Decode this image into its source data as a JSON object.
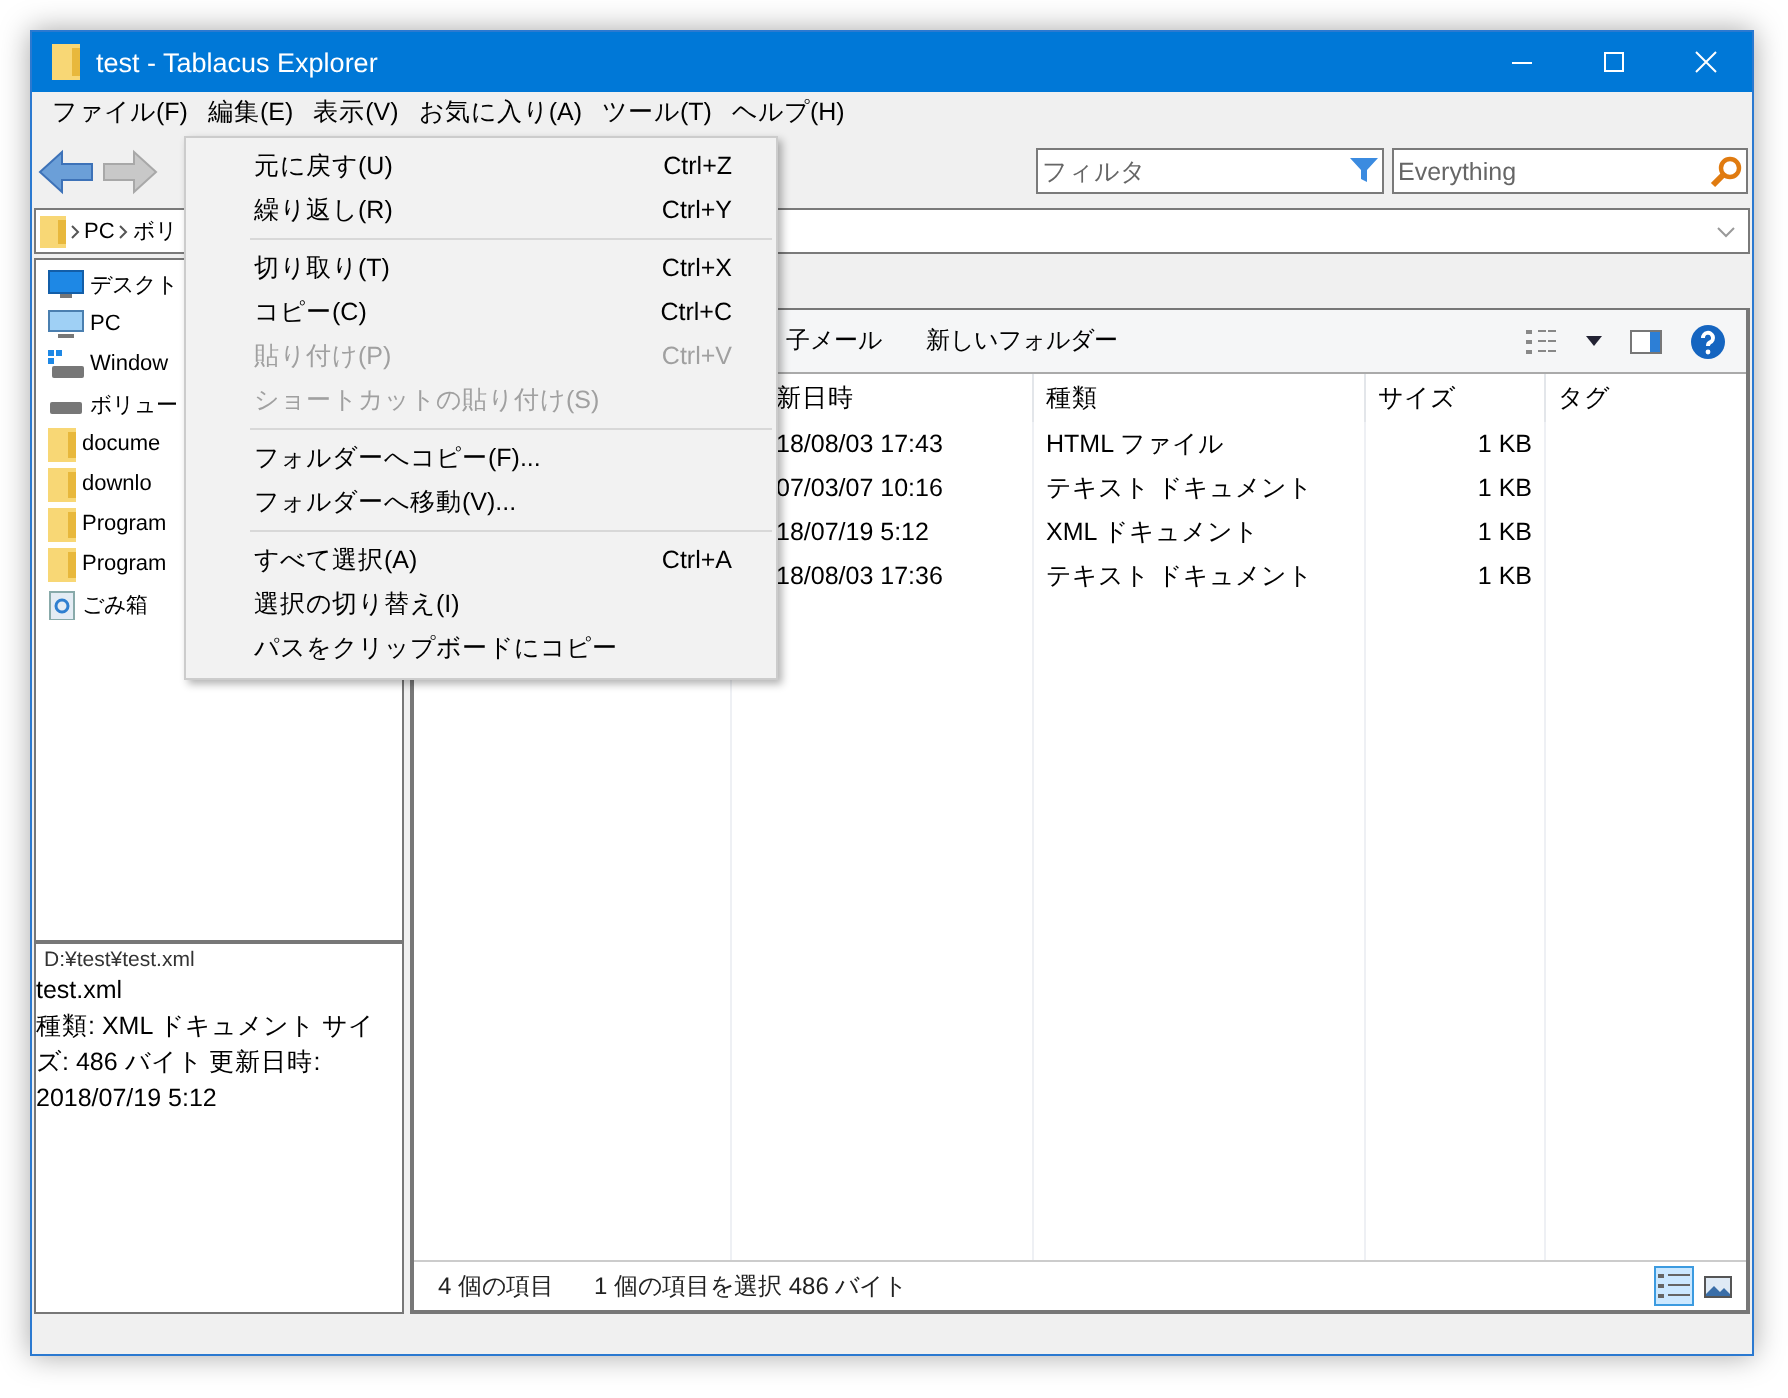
{
  "window": {
    "title": "test - Tablacus Explorer"
  },
  "menubar": [
    {
      "label": "ファイル(F)"
    },
    {
      "label": "編集(E)"
    },
    {
      "label": "表示(V)"
    },
    {
      "label": "お気に入り(A)"
    },
    {
      "label": "ツール(T)"
    },
    {
      "label": "ヘルプ(H)"
    }
  ],
  "filter": {
    "placeholder": "フィルタ"
  },
  "search": {
    "placeholder": "Everything"
  },
  "address": {
    "crumbs": [
      "PC",
      "ボリ"
    ]
  },
  "tree": [
    {
      "label": "デスクト",
      "kind": "desktop"
    },
    {
      "label": "PC",
      "kind": "pc"
    },
    {
      "label": "Window",
      "kind": "system-drive"
    },
    {
      "label": "ボリュー",
      "kind": "drive"
    },
    {
      "label": "docume",
      "kind": "folder"
    },
    {
      "label": "downlo",
      "kind": "folder"
    },
    {
      "label": "Program",
      "kind": "folder"
    },
    {
      "label": "Program",
      "kind": "folder"
    },
    {
      "label": "ごみ箱",
      "kind": "recycle"
    }
  ],
  "info": {
    "path": "D:¥test¥test.xml",
    "name": "test.xml",
    "details": "種類: XML ドキュメント サイズ: 486 バイト 更新日時: 2018/07/19 5:12"
  },
  "command_bar": {
    "items": [
      "子メール",
      "新しいフォルダー"
    ]
  },
  "table": {
    "columns": [
      "新日時",
      "種類",
      "サイズ",
      "タグ"
    ],
    "rows": [
      {
        "date": "18/08/03 17:43",
        "type": "HTML ファイル",
        "size": "1 KB"
      },
      {
        "date": "07/03/07 10:16",
        "type": "テキスト ドキュメント",
        "size": "1 KB"
      },
      {
        "date": "18/07/19 5:12",
        "type": "XML ドキュメント",
        "size": "1 KB"
      },
      {
        "date": "18/08/03 17:36",
        "type": "テキスト ドキュメント",
        "size": "1 KB"
      }
    ]
  },
  "status_bar": {
    "items": [
      "4 個の項目",
      "1 個の項目を選択  486 バイト"
    ],
    "views": [
      {
        "kind": "details",
        "selected": true
      },
      {
        "kind": "preview",
        "selected": false
      }
    ]
  },
  "context_menu": {
    "items": [
      {
        "kind": "item",
        "label": "元に戻す(U)",
        "shortcut": "Ctrl+Z",
        "disabled": false
      },
      {
        "kind": "item",
        "label": "繰り返し(R)",
        "shortcut": "Ctrl+Y",
        "disabled": false
      },
      {
        "kind": "separator"
      },
      {
        "kind": "item",
        "label": "切り取り(T)",
        "shortcut": "Ctrl+X",
        "disabled": false
      },
      {
        "kind": "item",
        "label": "コピー(C)",
        "shortcut": "Ctrl+C",
        "disabled": false
      },
      {
        "kind": "item",
        "label": "貼り付け(P)",
        "shortcut": "Ctrl+V",
        "disabled": true
      },
      {
        "kind": "item",
        "label": "ショートカットの貼り付け(S)",
        "disabled": true
      },
      {
        "kind": "separator"
      },
      {
        "kind": "item",
        "label": "フォルダーへコピー(F)...",
        "disabled": false
      },
      {
        "kind": "item",
        "label": "フォルダーへ移動(V)...",
        "disabled": false
      },
      {
        "kind": "separator"
      },
      {
        "kind": "item",
        "label": "すべて選択(A)",
        "shortcut": "Ctrl+A",
        "disabled": false
      },
      {
        "kind": "item",
        "label": "選択の切り替え(I)",
        "disabled": false
      },
      {
        "kind": "item",
        "label": "パスをクリップボードにコピー",
        "disabled": false
      }
    ]
  }
}
